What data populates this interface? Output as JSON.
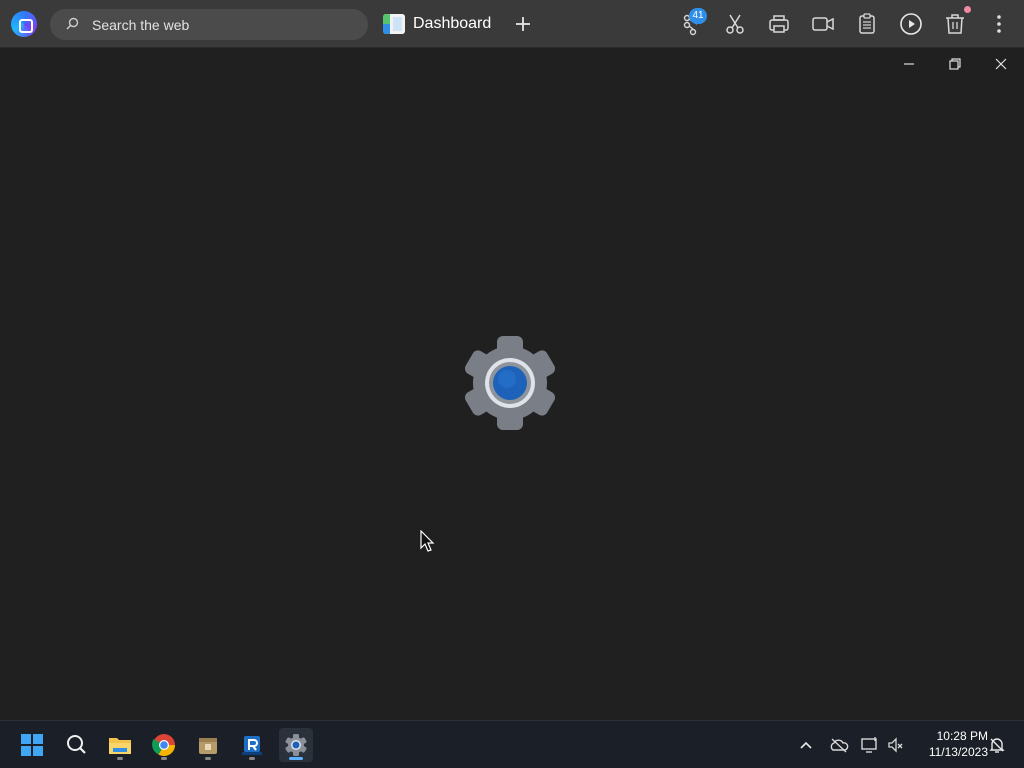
{
  "browser": {
    "search_placeholder": "Search the web",
    "tab_title": "Dashboard",
    "badge_count": "41"
  },
  "toolbar_icons": [
    "network-icon",
    "scissors-icon",
    "printer-icon",
    "video-icon",
    "clipboard-icon",
    "play-icon",
    "trash-icon",
    "more-icon"
  ],
  "window_controls": [
    "minimize-icon",
    "restore-icon",
    "close-icon"
  ],
  "taskbar": {
    "apps": [
      "windows-start-icon",
      "search-icon",
      "file-explorer-icon",
      "chrome-icon",
      "package-icon",
      "r-app-icon",
      "settings-icon"
    ],
    "clock_time": "10:28 PM",
    "clock_date": "11/13/2023"
  },
  "colors": {
    "background": "#202020",
    "topbar": "#3a3a3a",
    "taskbar": "#1b1f27",
    "accent_blue": "#1d62b8",
    "gear_gray": "#7a7f87"
  }
}
